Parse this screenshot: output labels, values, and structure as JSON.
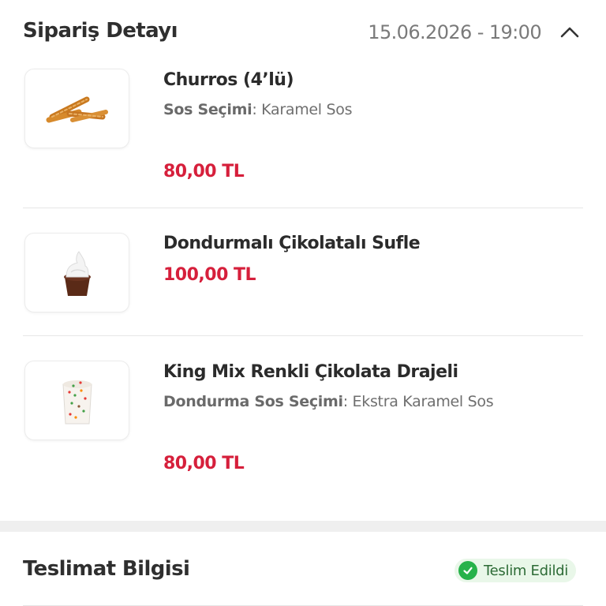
{
  "header": {
    "title": "Sipariş Detayı",
    "datetime": "15.06.2026 - 19:00",
    "toggle_icon": "chevron-up-icon"
  },
  "items": [
    {
      "name": "Churros (4’lü)",
      "option_key": "Sos Seçimi",
      "option_value": "Karamel Sos",
      "price": "80,00 TL",
      "image_icon": "churros-image"
    },
    {
      "name": "Dondurmalı Çikolatalı Sufle",
      "price": "100,00 TL",
      "image_icon": "sufle-image"
    },
    {
      "name": "King Mix Renkli Çikolata Drajeli",
      "option_key": "Dondurma Sos Seçimi",
      "option_value": "Ekstra Karamel Sos",
      "price": "80,00 TL",
      "image_icon": "king-mix-image"
    }
  ],
  "delivery": {
    "title": "Teslimat Bilgisi",
    "status": "Teslim Edildi",
    "status_icon": "check-circle-icon",
    "status_color": "#26b24a"
  },
  "colors": {
    "price": "#d61f3b",
    "badge_bg": "#e9f7e9"
  }
}
